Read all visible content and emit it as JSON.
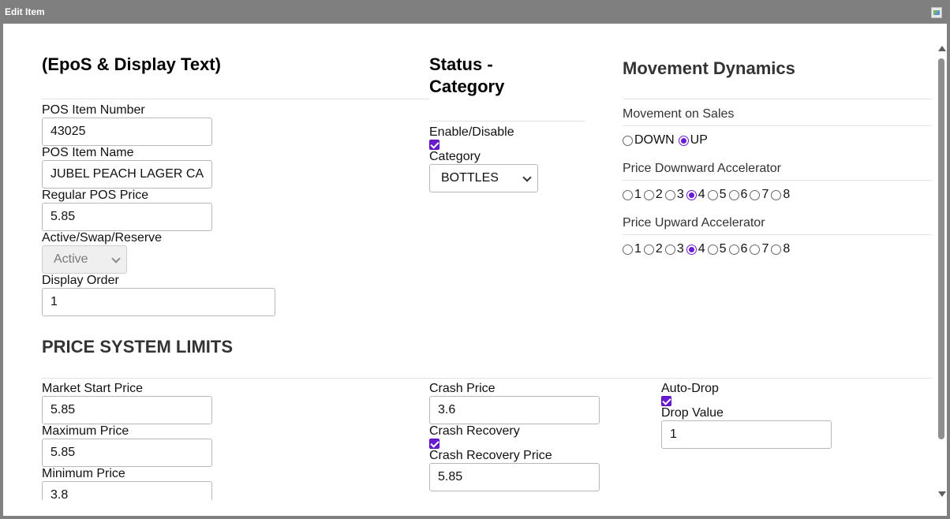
{
  "window": {
    "title": "Edit Item",
    "title_icon": "broken-image-icon"
  },
  "epos": {
    "heading": "(EpoS & Display Text)",
    "pos_item_number": {
      "label": "POS Item Number",
      "value": "43025"
    },
    "pos_item_name": {
      "label": "POS Item Name",
      "value": "JUBEL PEACH LAGER CA"
    },
    "regular_pos_price": {
      "label": "Regular POS Price",
      "value": "5.85"
    },
    "active_swap_reserve": {
      "label": "Active/Swap/Reserve",
      "value": "Active"
    },
    "display_order": {
      "label": "Display Order",
      "value": "1"
    }
  },
  "status": {
    "heading_line1": "Status -",
    "heading_line2": "Category",
    "enable_label": "Enable/Disable",
    "enabled": true,
    "category_label": "Category",
    "category_value": "BOTTLES"
  },
  "movement": {
    "heading": "Movement Dynamics",
    "on_sales_label": "Movement on Sales",
    "on_sales_options": [
      "DOWN",
      "UP"
    ],
    "on_sales_selected": "UP",
    "downward_label": "Price Downward Accelerator",
    "downward_options": [
      "1",
      "2",
      "3",
      "4",
      "5",
      "6",
      "7",
      "8"
    ],
    "downward_selected": "4",
    "upward_label": "Price Upward Accelerator",
    "upward_options": [
      "1",
      "2",
      "3",
      "4",
      "5",
      "6",
      "7",
      "8"
    ],
    "upward_selected": "4"
  },
  "limits": {
    "heading": "PRICE SYSTEM LIMITS",
    "market_start_price": {
      "label": "Market Start Price",
      "value": "5.85"
    },
    "maximum_price": {
      "label": "Maximum Price",
      "value": "5.85"
    },
    "minimum_price": {
      "label": "Minimum Price",
      "value": "3.8"
    },
    "crash_price": {
      "label": "Crash Price",
      "value": "3.6"
    },
    "crash_recovery": {
      "label": "Crash Recovery",
      "checked": true
    },
    "crash_recovery_price": {
      "label": "Crash Recovery Price",
      "value": "5.85"
    },
    "auto_drop": {
      "label": "Auto-Drop",
      "checked": true
    },
    "drop_value": {
      "label": "Drop Value",
      "value": "1"
    }
  },
  "colors": {
    "accent": "#6a1bd1",
    "titlebar": "#7f7f7f"
  }
}
